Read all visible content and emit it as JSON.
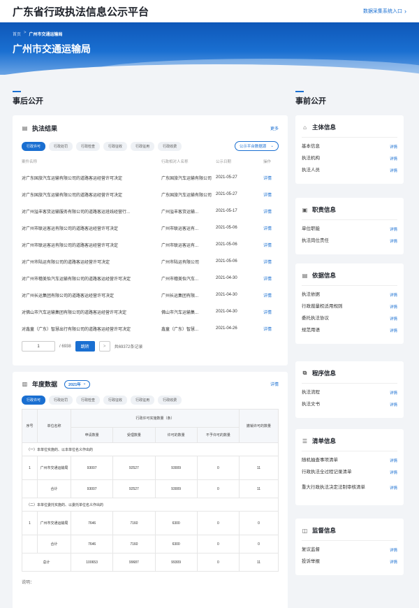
{
  "header": {
    "site_title": "广东省行政执法信息公示平台",
    "entry_link": "数据采集系统入口"
  },
  "banner": {
    "crumb_home": "首页",
    "crumb_sep": ">",
    "crumb_current": "广州市交通运输局",
    "org_title": "广州市交通运输局"
  },
  "left_section": "事后公开",
  "right_section": "事前公开",
  "results": {
    "title": "执法结果",
    "more": "更多",
    "tabs": [
      "行政许可",
      "行政处罚",
      "行政检查",
      "行政征收",
      "行政征用",
      "行政收费"
    ],
    "source_select": "公示平台数据源",
    "columns": [
      "案件名称",
      "行政相对人名称",
      "公示日期",
      "操作"
    ],
    "rows": [
      {
        "name": "对广东国旅汽车运输有限公司的道路客运经营许可决定",
        "party": "广东国旅汽车运输有限公司",
        "date": "2021-05-27",
        "op": "详情"
      },
      {
        "name": "对广东国旅汽车运输有限公司的道路客运经营许可决定",
        "party": "广东国旅汽车运输有限公司",
        "date": "2021-05-27",
        "op": "详情"
      },
      {
        "name": "对广州溢丰客货运输服务有限公司的道路客运班线经营行...",
        "party": "广州溢丰客货运输...",
        "date": "2021-05-17",
        "op": "详情"
      },
      {
        "name": "对广州市联运客运有限公司的道路客运经营许可决定",
        "party": "广州市联运客运有...",
        "date": "2021-05-06",
        "op": "详情"
      },
      {
        "name": "对广州市联运客运有限公司的道路客运经营许可决定",
        "party": "广州市联运客运有...",
        "date": "2021-05-06",
        "op": "详情"
      },
      {
        "name": "对广州市陆运有限公司的道路客运经营许可决定",
        "party": "广州市陆运有限公司",
        "date": "2021-05-06",
        "op": "详情"
      },
      {
        "name": "对广州市穗美怡汽车运输有限公司的道路客运经营许可决定",
        "party": "广州市穗美怡汽车...",
        "date": "2021-04-30",
        "op": "详情"
      },
      {
        "name": "对广州长运集团有限公司的道路客运经营许可决定",
        "party": "广州长运集团有限...",
        "date": "2021-04-30",
        "op": "详情"
      },
      {
        "name": "对佛山市汽车运输集团有限公司的道路客运经营许可决定",
        "party": "佛山市汽车运输集...",
        "date": "2021-04-30",
        "op": "详情"
      },
      {
        "name": "对鑫童（广东）智慧出行有限公司的道路客运经营许可决定",
        "party": "鑫童（广东）智慧...",
        "date": "2021-04-26",
        "op": "详情"
      }
    ],
    "pager": {
      "page": "1",
      "total_pages": "/ 6938",
      "jump": "跳转",
      "next": ">",
      "total": "共69372条记录"
    }
  },
  "annual": {
    "title": "年度数据",
    "year": "2021年",
    "more": "详情",
    "tabs": [
      "行政许可",
      "行政处罚",
      "行政检查",
      "行政征收",
      "行政征用",
      "行政收费"
    ],
    "headers": {
      "no": "序号",
      "unit": "单位名称",
      "impl": "行政许可实施数量（条）",
      "revoked": "撤销许可的数量",
      "applied": "申请数量",
      "accepted": "受理数量",
      "granted": "许可的数量",
      "denied": "不予许可的数量"
    },
    "sec1": "（一）本单位实施的、以本单位名义作出的",
    "sec1_rows": [
      {
        "no": "1",
        "unit": "广州市交通运输局",
        "applied": "93007",
        "accepted": "92527",
        "granted": "93009",
        "denied": "0",
        "revoked": "11"
      },
      {
        "no": "",
        "unit": "合计",
        "applied": "93007",
        "accepted": "92527",
        "granted": "93009",
        "denied": "0",
        "revoked": "11"
      }
    ],
    "sec2": "（二）本单位委托实施的、以委托单位名义作出的",
    "sec2_rows": [
      {
        "no": "1",
        "unit": "广州市交通运输局",
        "applied": "7646",
        "accepted": "7160",
        "granted": "6300",
        "denied": "0",
        "revoked": "0"
      },
      {
        "no": "",
        "unit": "合计",
        "applied": "7646",
        "accepted": "7160",
        "granted": "6300",
        "denied": "0",
        "revoked": "0"
      }
    ],
    "total": {
      "label": "总计",
      "applied": "100653",
      "accepted": "99687",
      "granted": "99309",
      "denied": "0",
      "revoked": "11"
    },
    "note": "说明："
  },
  "side": [
    {
      "title": "主体信息",
      "icon": "bank-icon",
      "items": [
        "基本信息",
        "执法机构",
        "执法人员"
      ]
    },
    {
      "title": "职责信息",
      "icon": "document-icon",
      "items": [
        "单位职能",
        "执法岗位责任"
      ]
    },
    {
      "title": "依据信息",
      "icon": "book-icon",
      "items": [
        "执法依据",
        "行政裁量权适用规则",
        "委托执法协议",
        "规范用语"
      ]
    },
    {
      "title": "程序信息",
      "icon": "flow-icon",
      "items": [
        "执法流程",
        "执法文书"
      ]
    },
    {
      "title": "清单信息",
      "icon": "list-icon",
      "items": [
        "随机抽查事项清单",
        "行政执法全过程记录清单",
        "重大行政执法决定法制审核清单"
      ]
    },
    {
      "title": "监督信息",
      "icon": "monitor-icon",
      "items": [
        "复议监督",
        "投诉举报"
      ]
    }
  ],
  "side_link": "详情"
}
